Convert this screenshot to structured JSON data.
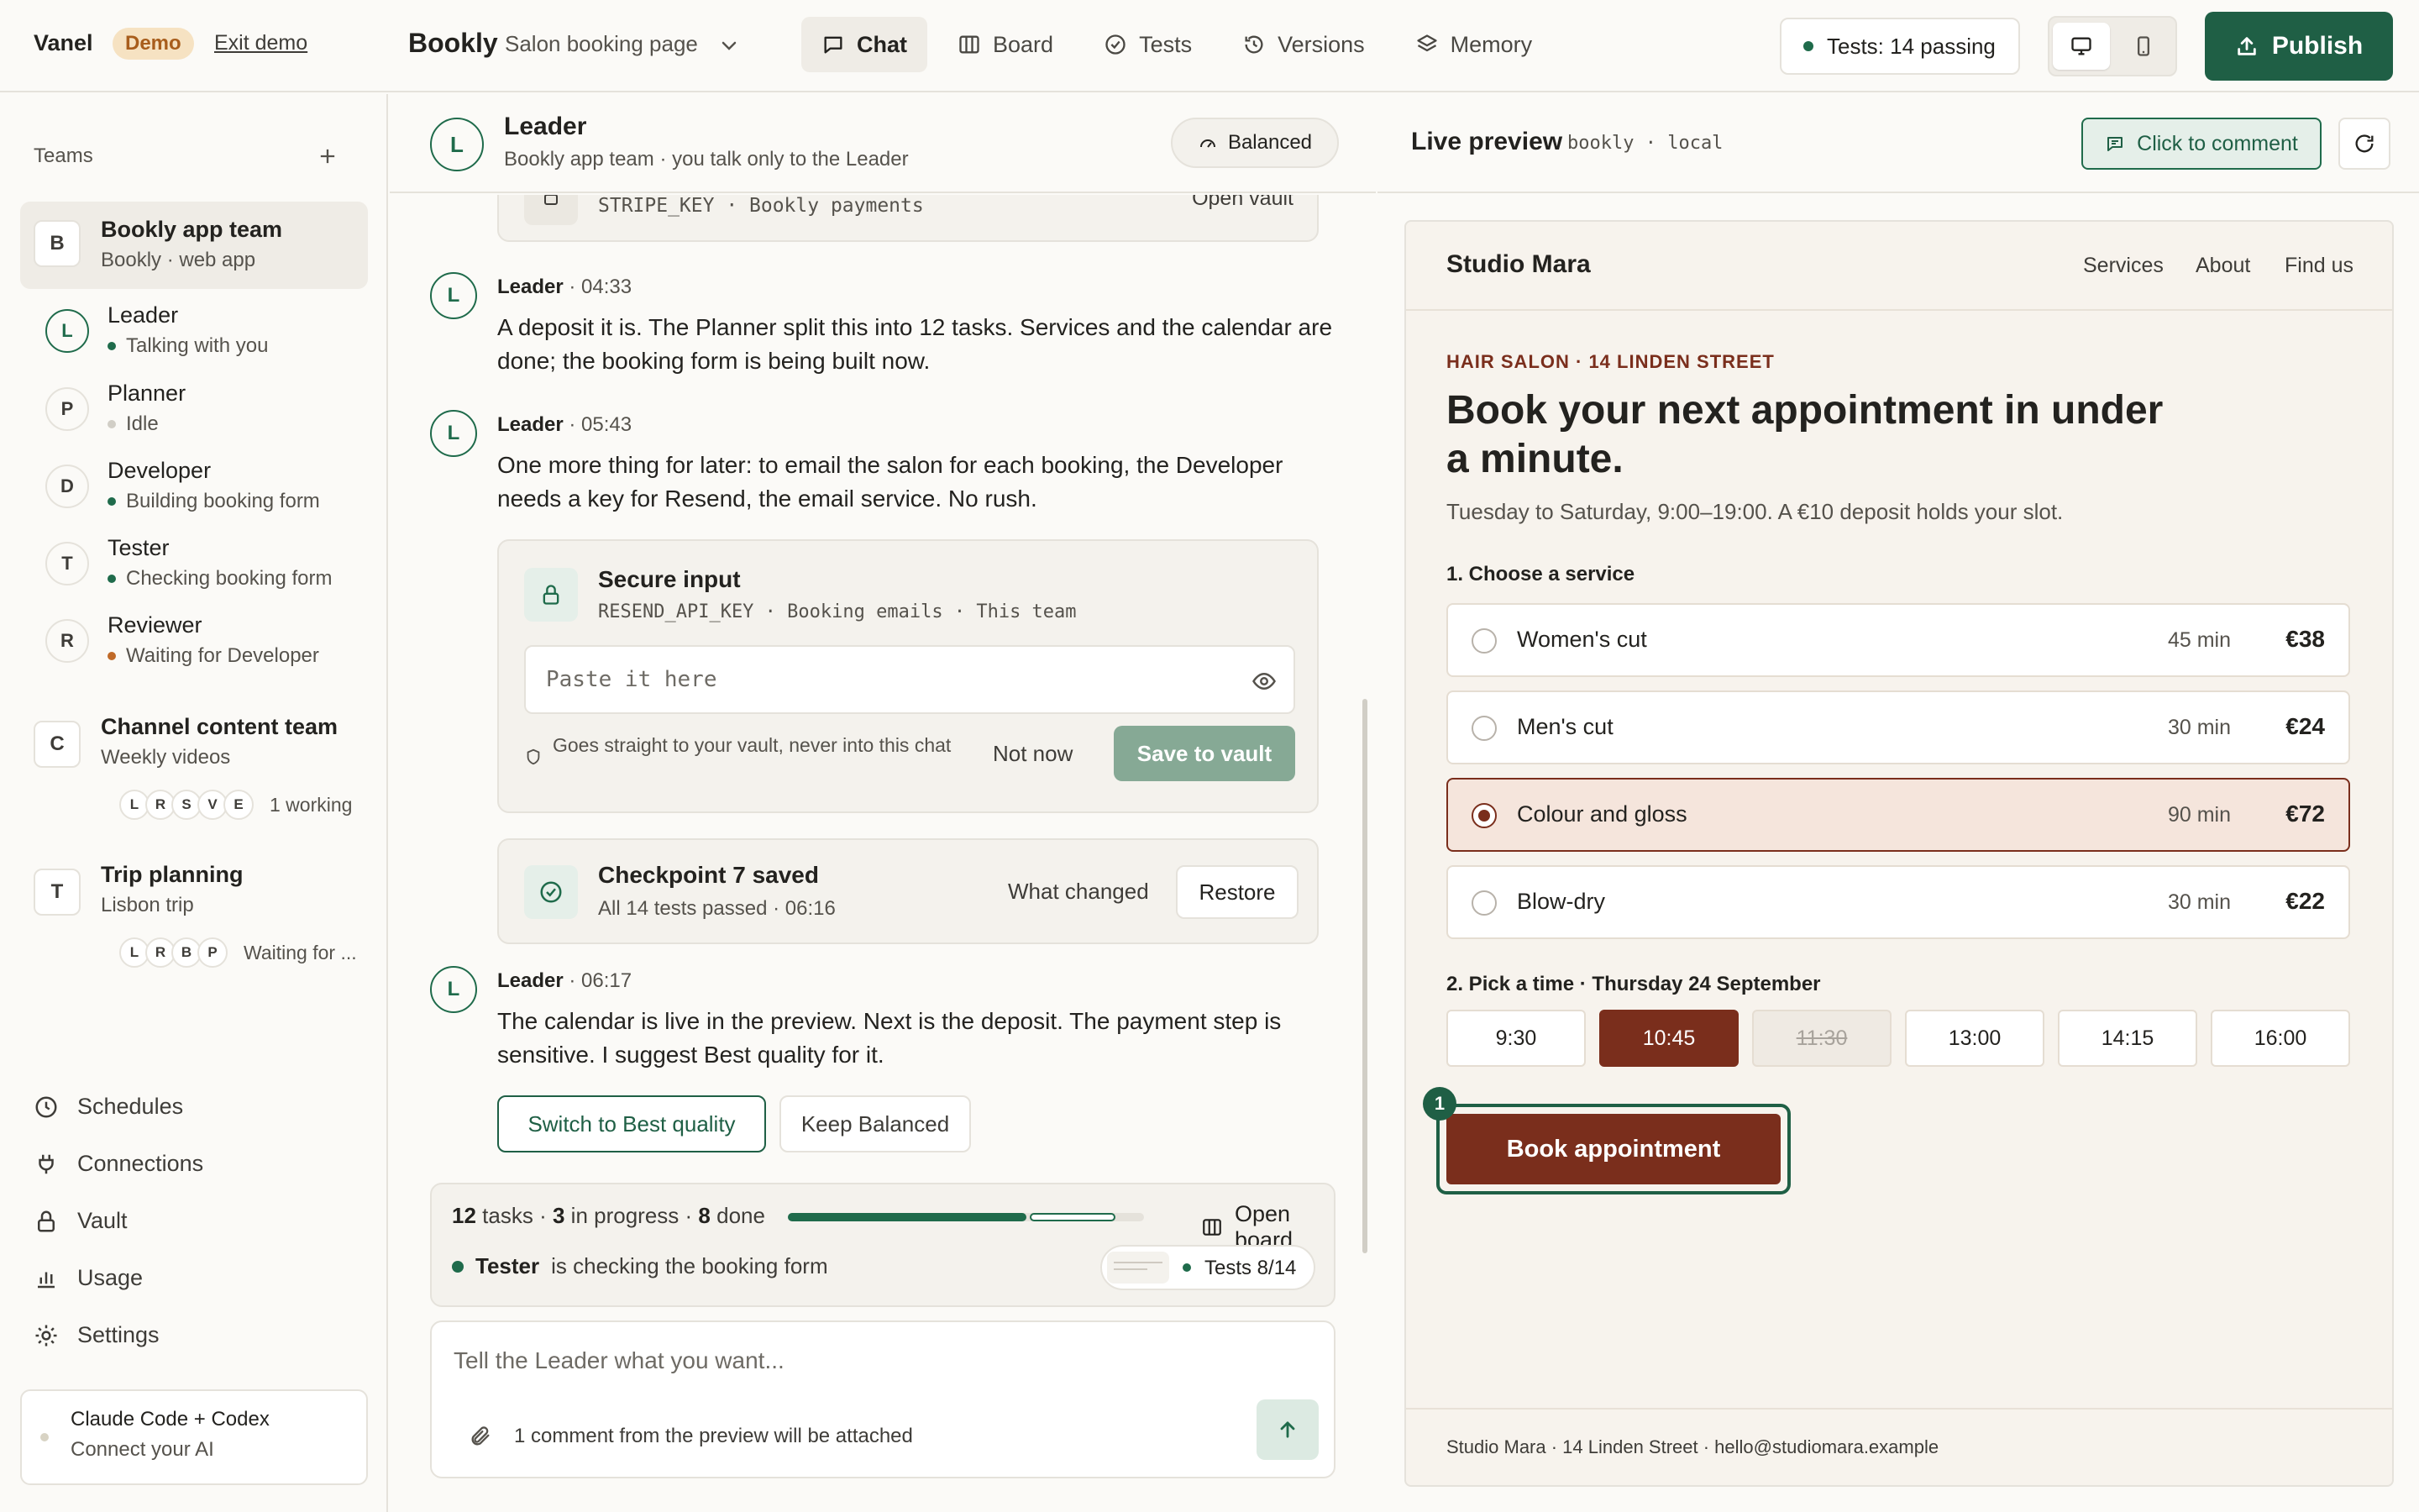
{
  "topbar": {
    "brand": "Vanel",
    "demo_badge": "Demo",
    "exit_demo": "Exit demo",
    "project_name": "Bookly",
    "project_sub": "Salon booking page",
    "tabs": [
      {
        "label": "Chat",
        "icon": "chat-icon",
        "active": true
      },
      {
        "label": "Board",
        "icon": "board-icon"
      },
      {
        "label": "Tests",
        "icon": "check-circle-icon"
      },
      {
        "label": "Versions",
        "icon": "history-icon"
      },
      {
        "label": "Memory",
        "icon": "layers-icon"
      }
    ],
    "tests_status": "Tests: 14 passing",
    "publish_label": "Publish"
  },
  "sidebar": {
    "teams_label": "Teams",
    "teams": [
      {
        "initial": "B",
        "name": "Bookly app team",
        "sub": "Bookly · web app",
        "members": [
          {
            "initial": "L",
            "name": "Leader",
            "status": "Talking with you",
            "state": "active"
          },
          {
            "initial": "P",
            "name": "Planner",
            "status": "Idle",
            "state": "idle"
          },
          {
            "initial": "D",
            "name": "Developer",
            "status": "Building booking form",
            "state": "active"
          },
          {
            "initial": "T",
            "name": "Tester",
            "status": "Checking booking form",
            "state": "active"
          },
          {
            "initial": "R",
            "name": "Reviewer",
            "status": "Waiting for Developer",
            "state": "waiting"
          }
        ]
      },
      {
        "initial": "C",
        "name": "Channel content team",
        "sub": "Weekly videos",
        "avatars": [
          "L",
          "R",
          "S",
          "V",
          "E"
        ],
        "status": "1 working"
      },
      {
        "initial": "T",
        "name": "Trip planning",
        "sub": "Lisbon trip",
        "avatars": [
          "L",
          "R",
          "B",
          "P"
        ],
        "status": "Waiting for ..."
      }
    ],
    "nav": [
      {
        "label": "Schedules",
        "icon": "clock-icon"
      },
      {
        "label": "Connections",
        "icon": "plug-icon"
      },
      {
        "label": "Vault",
        "icon": "lock-icon"
      },
      {
        "label": "Usage",
        "icon": "bar-chart-icon"
      },
      {
        "label": "Settings",
        "icon": "gear-icon"
      }
    ],
    "ai_connect": {
      "title": "Claude Code + Codex",
      "sub": "Connect your AI"
    }
  },
  "chat": {
    "header": {
      "initial": "L",
      "title": "Leader",
      "sub": "Bookly app team · you talk only to the Leader",
      "mode": "Balanced"
    },
    "prev_card": {
      "key": "STRIPE_KEY · Bookly payments",
      "action": "Open vault"
    },
    "messages": [
      {
        "author": "Leader",
        "time": "04:33",
        "text": "A deposit it is. The Planner split this into 12 tasks. Services and the calendar are done; the booking form is being built now."
      },
      {
        "author": "Leader",
        "time": "05:43",
        "text": "One more thing for later: to email the salon for each booking, the Developer needs a key for Resend, the email service. No rush."
      },
      {
        "author": "Leader",
        "time": "06:17",
        "text": "The calendar is live in the preview. Next is the deposit. The payment step is sensitive. I suggest Best quality for it."
      }
    ],
    "secure_input": {
      "title": "Secure input",
      "key": "RESEND_API_KEY · Booking emails · This team",
      "placeholder": "Paste it here",
      "note": "Goes straight to your vault, never into this chat",
      "not_now": "Not now",
      "save": "Save to vault"
    },
    "checkpoint": {
      "title": "Checkpoint 7 saved",
      "sub": "All 14 tests passed · 06:16",
      "what_changed": "What changed",
      "restore": "Restore"
    },
    "quality_buttons": {
      "switch": "Switch to Best quality",
      "keep": "Keep Balanced"
    },
    "status": {
      "total": "12",
      "total_label": "tasks ·",
      "in_progress": "3",
      "in_progress_label": "in progress ·",
      "done": "8",
      "done_label": "done",
      "progress_done": 0.67,
      "progress_active": 0.25,
      "open_board": "Open board",
      "agent": "Tester",
      "agent_text": "is checking the booking form",
      "tests": "Tests 8/14"
    },
    "composer": {
      "placeholder": "Tell the Leader what you want...",
      "attach_note": "1 comment from the preview will be attached"
    }
  },
  "preview": {
    "title": "Live preview",
    "url": "bookly · local",
    "comment_label": "Click to comment",
    "site": {
      "brand": "Studio Mara",
      "nav": [
        "Services",
        "About",
        "Find us"
      ],
      "eyebrow": "HAIR SALON · 14 LINDEN STREET",
      "headline_1": "Book your next appointment in under",
      "headline_2": "a minute.",
      "subtext": "Tuesday to Saturday, 9:00–19:00. A €10 deposit holds your slot.",
      "step1": "1. Choose a service",
      "services": [
        {
          "name": "Women's cut",
          "duration": "45 min",
          "price": "€38",
          "selected": false
        },
        {
          "name": "Men's cut",
          "duration": "30 min",
          "price": "€24",
          "selected": false
        },
        {
          "name": "Colour and gloss",
          "duration": "90 min",
          "price": "€72",
          "selected": true
        },
        {
          "name": "Blow-dry",
          "duration": "30 min",
          "price": "€22",
          "selected": false
        }
      ],
      "step2": "2. Pick a time · Thursday 24 September",
      "times": [
        {
          "label": "9:30",
          "state": "normal"
        },
        {
          "label": "10:45",
          "state": "selected"
        },
        {
          "label": "11:30",
          "state": "disabled"
        },
        {
          "label": "13:00",
          "state": "normal"
        },
        {
          "label": "14:15",
          "state": "normal"
        },
        {
          "label": "16:00",
          "state": "normal"
        }
      ],
      "comment_marker": "1",
      "book_label": "Book appointment",
      "footer": "Studio Mara · 14 Linden Street · hello@studiomara.example"
    }
  },
  "colors": {
    "brand_green": "#1f5f45",
    "accent_rust": "#7a2e1c",
    "waiting_orange": "#c06a28"
  }
}
